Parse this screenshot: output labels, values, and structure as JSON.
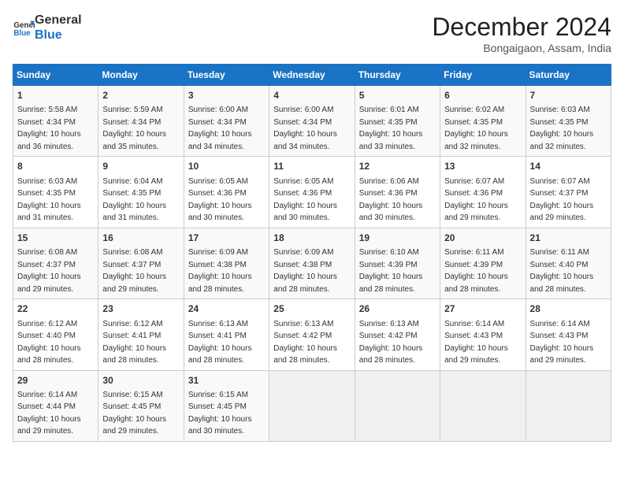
{
  "header": {
    "logo_line1": "General",
    "logo_line2": "Blue",
    "month_title": "December 2024",
    "location": "Bongaigaon, Assam, India"
  },
  "days_of_week": [
    "Sunday",
    "Monday",
    "Tuesday",
    "Wednesday",
    "Thursday",
    "Friday",
    "Saturday"
  ],
  "weeks": [
    [
      {
        "day": "1",
        "detail": "Sunrise: 5:58 AM\nSunset: 4:34 PM\nDaylight: 10 hours\nand 36 minutes."
      },
      {
        "day": "2",
        "detail": "Sunrise: 5:59 AM\nSunset: 4:34 PM\nDaylight: 10 hours\nand 35 minutes."
      },
      {
        "day": "3",
        "detail": "Sunrise: 6:00 AM\nSunset: 4:34 PM\nDaylight: 10 hours\nand 34 minutes."
      },
      {
        "day": "4",
        "detail": "Sunrise: 6:00 AM\nSunset: 4:34 PM\nDaylight: 10 hours\nand 34 minutes."
      },
      {
        "day": "5",
        "detail": "Sunrise: 6:01 AM\nSunset: 4:35 PM\nDaylight: 10 hours\nand 33 minutes."
      },
      {
        "day": "6",
        "detail": "Sunrise: 6:02 AM\nSunset: 4:35 PM\nDaylight: 10 hours\nand 32 minutes."
      },
      {
        "day": "7",
        "detail": "Sunrise: 6:03 AM\nSunset: 4:35 PM\nDaylight: 10 hours\nand 32 minutes."
      }
    ],
    [
      {
        "day": "8",
        "detail": "Sunrise: 6:03 AM\nSunset: 4:35 PM\nDaylight: 10 hours\nand 31 minutes."
      },
      {
        "day": "9",
        "detail": "Sunrise: 6:04 AM\nSunset: 4:35 PM\nDaylight: 10 hours\nand 31 minutes."
      },
      {
        "day": "10",
        "detail": "Sunrise: 6:05 AM\nSunset: 4:36 PM\nDaylight: 10 hours\nand 30 minutes."
      },
      {
        "day": "11",
        "detail": "Sunrise: 6:05 AM\nSunset: 4:36 PM\nDaylight: 10 hours\nand 30 minutes."
      },
      {
        "day": "12",
        "detail": "Sunrise: 6:06 AM\nSunset: 4:36 PM\nDaylight: 10 hours\nand 30 minutes."
      },
      {
        "day": "13",
        "detail": "Sunrise: 6:07 AM\nSunset: 4:36 PM\nDaylight: 10 hours\nand 29 minutes."
      },
      {
        "day": "14",
        "detail": "Sunrise: 6:07 AM\nSunset: 4:37 PM\nDaylight: 10 hours\nand 29 minutes."
      }
    ],
    [
      {
        "day": "15",
        "detail": "Sunrise: 6:08 AM\nSunset: 4:37 PM\nDaylight: 10 hours\nand 29 minutes."
      },
      {
        "day": "16",
        "detail": "Sunrise: 6:08 AM\nSunset: 4:37 PM\nDaylight: 10 hours\nand 29 minutes."
      },
      {
        "day": "17",
        "detail": "Sunrise: 6:09 AM\nSunset: 4:38 PM\nDaylight: 10 hours\nand 28 minutes."
      },
      {
        "day": "18",
        "detail": "Sunrise: 6:09 AM\nSunset: 4:38 PM\nDaylight: 10 hours\nand 28 minutes."
      },
      {
        "day": "19",
        "detail": "Sunrise: 6:10 AM\nSunset: 4:39 PM\nDaylight: 10 hours\nand 28 minutes."
      },
      {
        "day": "20",
        "detail": "Sunrise: 6:11 AM\nSunset: 4:39 PM\nDaylight: 10 hours\nand 28 minutes."
      },
      {
        "day": "21",
        "detail": "Sunrise: 6:11 AM\nSunset: 4:40 PM\nDaylight: 10 hours\nand 28 minutes."
      }
    ],
    [
      {
        "day": "22",
        "detail": "Sunrise: 6:12 AM\nSunset: 4:40 PM\nDaylight: 10 hours\nand 28 minutes."
      },
      {
        "day": "23",
        "detail": "Sunrise: 6:12 AM\nSunset: 4:41 PM\nDaylight: 10 hours\nand 28 minutes."
      },
      {
        "day": "24",
        "detail": "Sunrise: 6:13 AM\nSunset: 4:41 PM\nDaylight: 10 hours\nand 28 minutes."
      },
      {
        "day": "25",
        "detail": "Sunrise: 6:13 AM\nSunset: 4:42 PM\nDaylight: 10 hours\nand 28 minutes."
      },
      {
        "day": "26",
        "detail": "Sunrise: 6:13 AM\nSunset: 4:42 PM\nDaylight: 10 hours\nand 28 minutes."
      },
      {
        "day": "27",
        "detail": "Sunrise: 6:14 AM\nSunset: 4:43 PM\nDaylight: 10 hours\nand 29 minutes."
      },
      {
        "day": "28",
        "detail": "Sunrise: 6:14 AM\nSunset: 4:43 PM\nDaylight: 10 hours\nand 29 minutes."
      }
    ],
    [
      {
        "day": "29",
        "detail": "Sunrise: 6:14 AM\nSunset: 4:44 PM\nDaylight: 10 hours\nand 29 minutes."
      },
      {
        "day": "30",
        "detail": "Sunrise: 6:15 AM\nSunset: 4:45 PM\nDaylight: 10 hours\nand 29 minutes."
      },
      {
        "day": "31",
        "detail": "Sunrise: 6:15 AM\nSunset: 4:45 PM\nDaylight: 10 hours\nand 30 minutes."
      },
      {
        "day": "",
        "detail": ""
      },
      {
        "day": "",
        "detail": ""
      },
      {
        "day": "",
        "detail": ""
      },
      {
        "day": "",
        "detail": ""
      }
    ]
  ]
}
